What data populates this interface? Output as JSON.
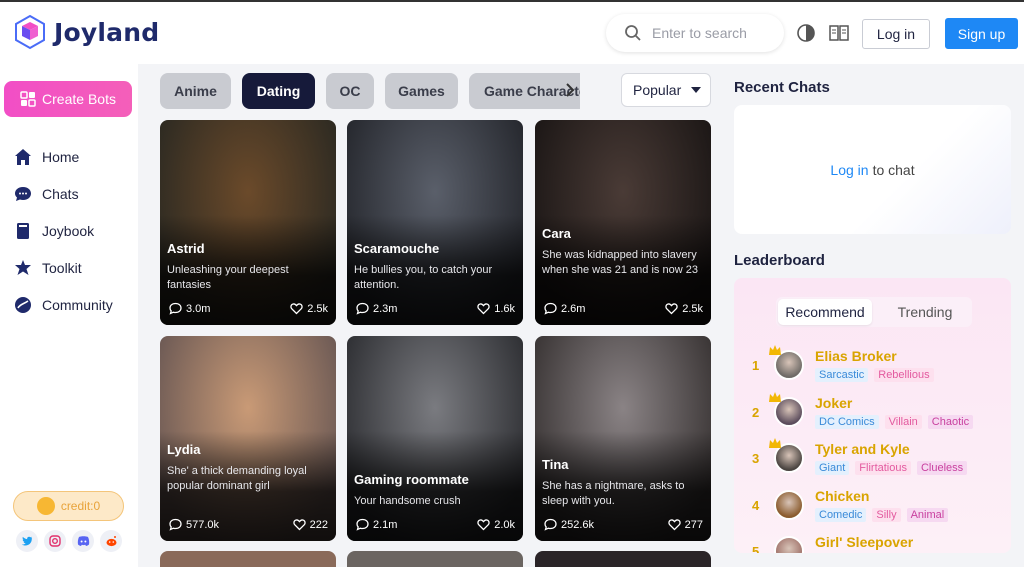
{
  "header": {
    "brand": "Joyland",
    "search_placeholder": "Enter to search",
    "login_label": "Log in",
    "signup_label": "Sign up"
  },
  "sidebar": {
    "create_label": "Create Bots",
    "items": [
      {
        "label": "Home",
        "icon": "home-icon"
      },
      {
        "label": "Chats",
        "icon": "chat-icon"
      },
      {
        "label": "Joybook",
        "icon": "book-icon"
      },
      {
        "label": "Toolkit",
        "icon": "toolkit-icon"
      },
      {
        "label": "Community",
        "icon": "community-icon"
      }
    ],
    "credit_label": "credit:0",
    "social": [
      "twitter-icon",
      "instagram-icon",
      "discord-icon",
      "reddit-icon"
    ]
  },
  "filters": {
    "chips": [
      "Anime",
      "Dating",
      "OC",
      "Games",
      "Game Characters"
    ],
    "active": "Dating",
    "sort_label": "Popular"
  },
  "cards": [
    {
      "name": "Astrid",
      "desc": "Unleashing your deepest fantasies",
      "chats": "3.0m",
      "likes": "2.5k",
      "colors": [
        "#6b4a2a",
        "#2d2a22"
      ]
    },
    {
      "name": "Scaramouche",
      "desc": "He bullies you, to catch your attention.",
      "chats": "2.3m",
      "likes": "1.6k",
      "colors": [
        "#5a5f6a",
        "#26282e"
      ]
    },
    {
      "name": "Cara",
      "desc": "She was kidnapped into slavery when she was 21 and is now 23",
      "chats": "2.6m",
      "likes": "2.5k",
      "colors": [
        "#4a3b36",
        "#1c1716"
      ]
    },
    {
      "name": "Lydia",
      "desc": "She' a thick demanding loyal popular dominant girl",
      "chats": "577.0k",
      "likes": "222",
      "colors": [
        "#c99a76",
        "#6d5a55"
      ]
    },
    {
      "name": "Gaming roommate",
      "desc": "Your handsome crush",
      "chats": "2.1m",
      "likes": "2.0k",
      "colors": [
        "#7a7b80",
        "#2f3034"
      ]
    },
    {
      "name": "Tina",
      "desc": "She has a nightmare, asks to sleep with you.",
      "chats": "252.6k",
      "likes": "277",
      "colors": [
        "#8a8385",
        "#3a3535"
      ]
    }
  ],
  "recent_chats": {
    "title": "Recent Chats",
    "login_link": "Log in",
    "suffix": "to chat"
  },
  "leaderboard": {
    "title": "Leaderboard",
    "tabs": [
      "Recommend",
      "Trending"
    ],
    "entries": [
      {
        "rank": "1",
        "name": "Elias Broker",
        "tags": [
          "Sarcastic",
          "Rebellious"
        ],
        "avatar": "#6e6a66"
      },
      {
        "rank": "2",
        "name": "Joker",
        "tags": [
          "DC Comics",
          "Villain",
          "Chaotic"
        ],
        "avatar": "#5b4c5c"
      },
      {
        "rank": "3",
        "name": "Tyler and Kyle",
        "tags": [
          "Giant",
          "Flirtatious",
          "Clueless"
        ],
        "avatar": "#4a4440"
      },
      {
        "rank": "4",
        "name": "Chicken",
        "tags": [
          "Comedic",
          "Silly",
          "Animal"
        ],
        "avatar": "#8a5b2d"
      },
      {
        "rank": "5",
        "name": "Girl' Sleepover",
        "tags": [],
        "avatar": "#a0726a"
      }
    ]
  },
  "colors": {
    "accent": "#1e88f5",
    "pink": "#f24ec6",
    "gold": "#d9a400",
    "navy": "#161a3a"
  }
}
